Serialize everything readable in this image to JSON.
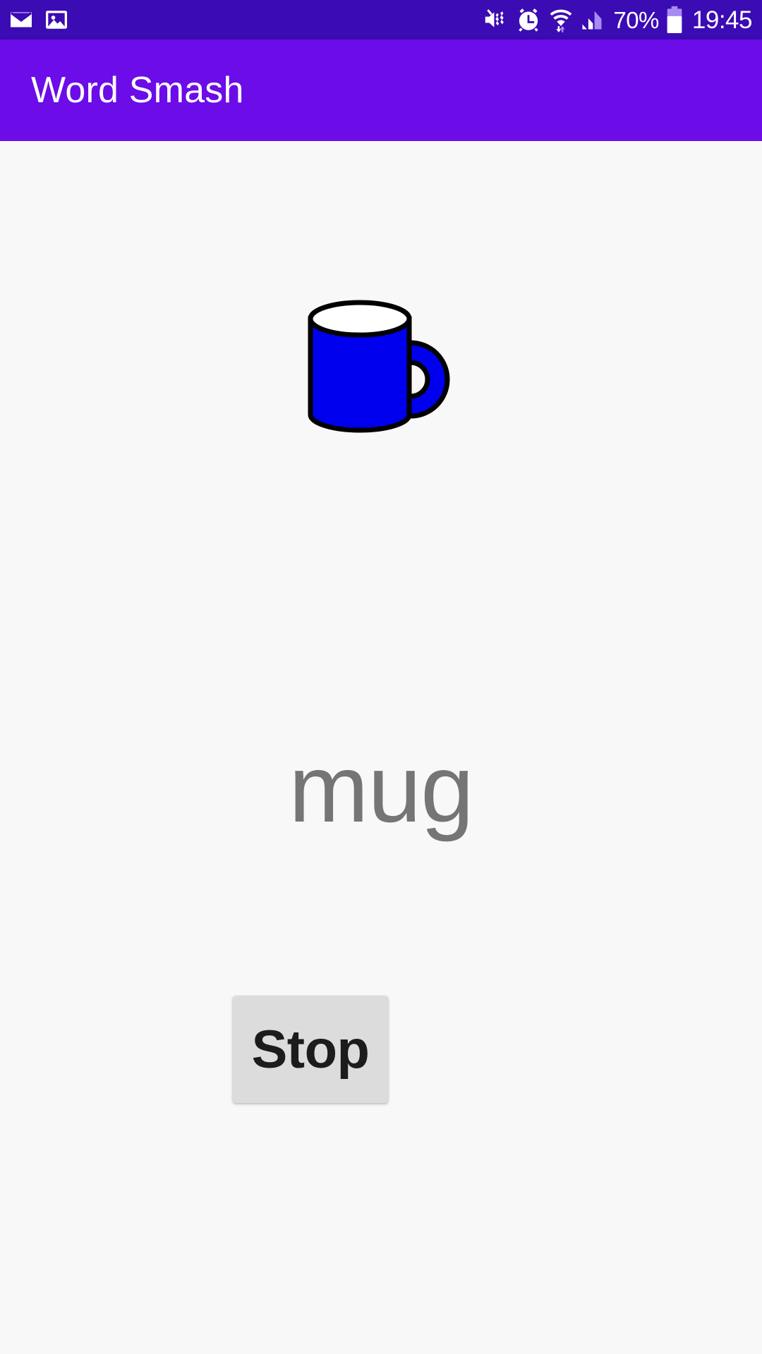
{
  "status_bar": {
    "background_color": "#3b0bb4",
    "left_icons": [
      {
        "name": "email-icon",
        "label": "Email"
      },
      {
        "name": "image-icon",
        "label": "Image"
      }
    ],
    "right_icons": [
      {
        "name": "mute-vibrate-icon",
        "label": "Sound off / vibrate"
      },
      {
        "name": "alarm-clock-icon",
        "label": "Alarm set"
      },
      {
        "name": "wifi-icon",
        "label": "Wi-Fi with data transfer"
      },
      {
        "name": "cell-signal-icon",
        "label": "Mobile signal"
      },
      {
        "name": "battery-icon",
        "label": "Battery"
      }
    ],
    "battery_percent": "70%",
    "battery_level": 70,
    "clock": "19:45"
  },
  "app_bar": {
    "title": "Word Smash",
    "background_color": "#6c0ce8",
    "text_color": "#ffffff"
  },
  "main": {
    "background_color": "#f8f8f8",
    "illustration": {
      "name": "mug-illustration",
      "alt": "Blue coffee mug",
      "body_color": "#0000ee",
      "rim_color": "#ffffff",
      "outline_color": "#000000"
    },
    "word": "mug",
    "word_color": "#757575",
    "button": {
      "label": "Stop",
      "background_color": "#dcdcdc",
      "text_color": "#1c1c1c"
    }
  }
}
